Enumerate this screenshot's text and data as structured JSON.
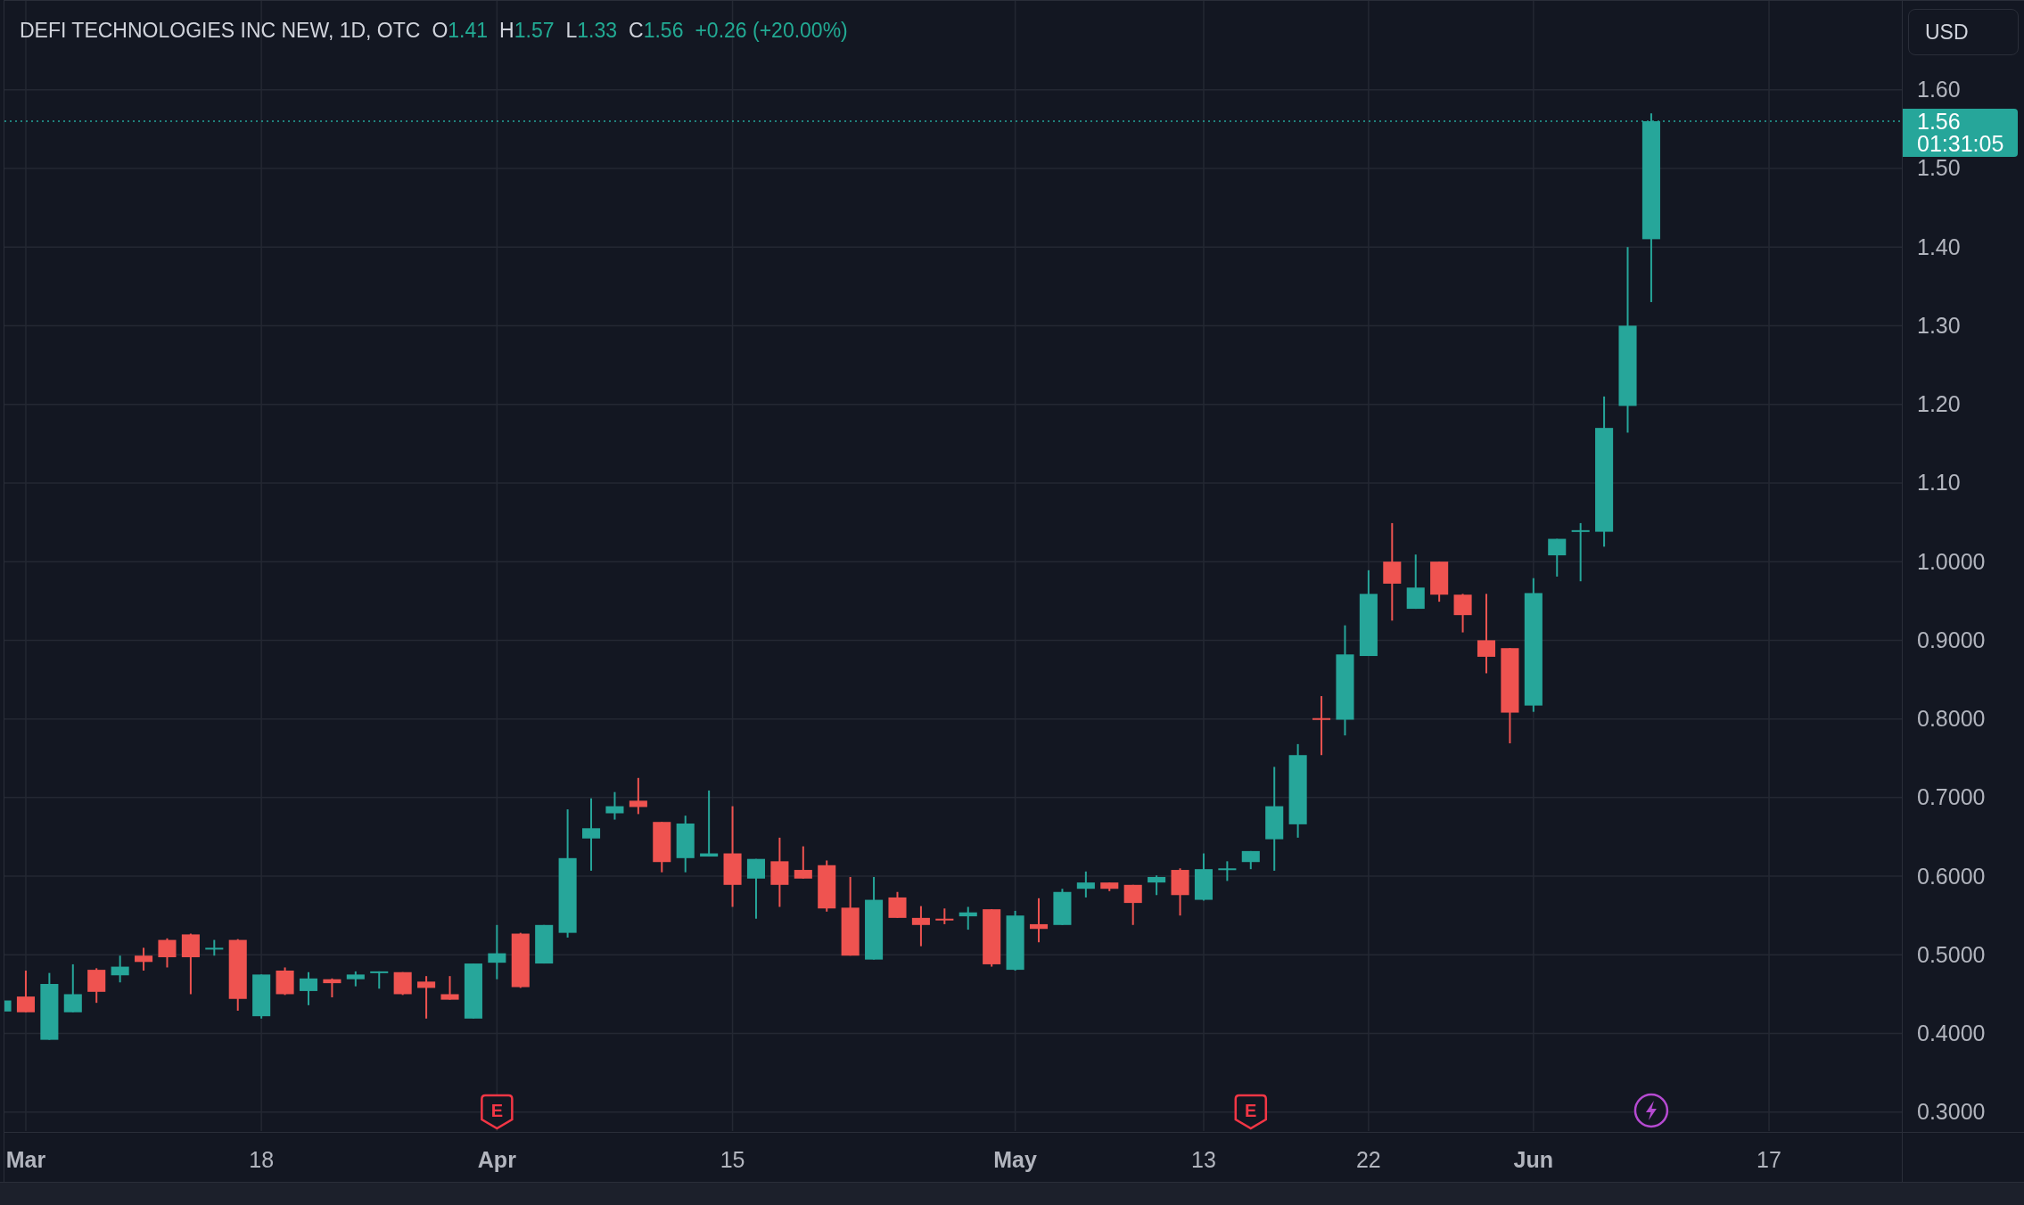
{
  "legend": {
    "title": "DEFI TECHNOLOGIES INC NEW, 1D, OTC",
    "values": [
      {
        "label": "O",
        "value": "1.41"
      },
      {
        "label": "H",
        "value": "1.57"
      },
      {
        "label": "L",
        "value": "1.33"
      },
      {
        "label": "C",
        "value": "1.56"
      }
    ],
    "change": "+0.26 (+20.00%)"
  },
  "price_axis": {
    "currency_button": "USD",
    "labels": [
      "1.60",
      "1.50",
      "1.40",
      "1.30",
      "1.20",
      "1.10",
      "1.0000",
      "0.9000",
      "0.8000",
      "0.7000",
      "0.6000",
      "0.5000",
      "0.4000",
      "0.3000"
    ],
    "price_tag": {
      "price": "1.56",
      "countdown": "01:31:05"
    }
  },
  "chart": {
    "events": [
      {
        "kind": "earnings",
        "label": "E"
      },
      {
        "kind": "earnings",
        "label": "E"
      },
      {
        "kind": "bolt"
      }
    ]
  },
  "time_axis": {
    "labels": [
      {
        "label": "Mar",
        "kind": "month"
      },
      {
        "label": "18",
        "kind": "day"
      },
      {
        "label": "Apr",
        "kind": "month"
      },
      {
        "label": "15",
        "kind": "day"
      },
      {
        "label": "May",
        "kind": "month"
      },
      {
        "label": "13",
        "kind": "day"
      },
      {
        "label": "22",
        "kind": "day"
      },
      {
        "label": "Jun",
        "kind": "month"
      },
      {
        "label": "17",
        "kind": "day"
      }
    ]
  }
}
